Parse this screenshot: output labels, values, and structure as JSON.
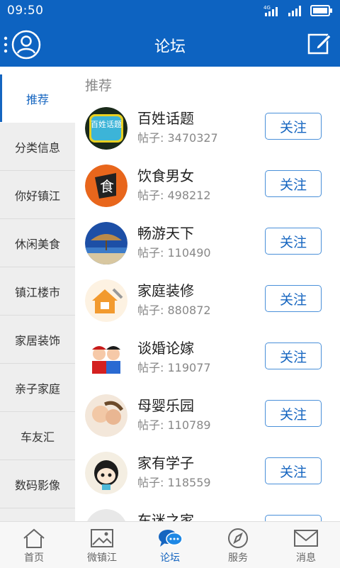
{
  "status_bar": {
    "time": "09:50",
    "network": "4G"
  },
  "app_bar": {
    "title": "论坛"
  },
  "sidebar": {
    "items": [
      {
        "label": "推荐",
        "active": true
      },
      {
        "label": "分类信息"
      },
      {
        "label": "你好镇江"
      },
      {
        "label": "休闲美食"
      },
      {
        "label": "镇江楼市"
      },
      {
        "label": "家居装饰"
      },
      {
        "label": "亲子家庭"
      },
      {
        "label": "车友汇"
      },
      {
        "label": "数码影像"
      }
    ]
  },
  "main": {
    "section_title": "推荐",
    "forums": [
      {
        "name": "百姓话题",
        "posts": "帖子: 3470327",
        "follow": "关注",
        "icon_text": "百姓话题"
      },
      {
        "name": "饮食男女",
        "posts": "帖子: 498212",
        "follow": "关注",
        "icon_text": "食"
      },
      {
        "name": "畅游天下",
        "posts": "帖子: 110490",
        "follow": "关注"
      },
      {
        "name": "家庭装修",
        "posts": "帖子: 880872",
        "follow": "关注"
      },
      {
        "name": "谈婚论嫁",
        "posts": "帖子: 119077",
        "follow": "关注"
      },
      {
        "name": "母婴乐园",
        "posts": "帖子: 110789",
        "follow": "关注"
      },
      {
        "name": "家有学子",
        "posts": "帖子: 118559",
        "follow": "关注"
      },
      {
        "name": "车迷之家",
        "posts": "",
        "follow": "关注"
      }
    ]
  },
  "bottom_nav": {
    "items": [
      {
        "label": "首页",
        "icon": "home-icon"
      },
      {
        "label": "微镇江",
        "icon": "image-icon"
      },
      {
        "label": "论坛",
        "icon": "chat-icon",
        "active": true
      },
      {
        "label": "服务",
        "icon": "compass-icon"
      },
      {
        "label": "消息",
        "icon": "mail-icon"
      }
    ]
  },
  "colors": {
    "primary": "#0d63c1",
    "accent": "#1565c0",
    "follow_border": "#4a90d9"
  }
}
